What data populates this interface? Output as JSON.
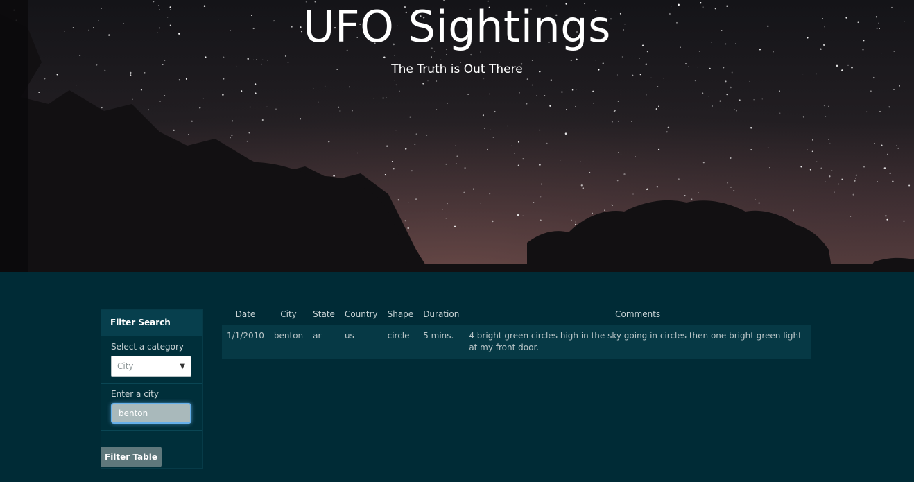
{
  "header": {
    "title": "UFO Sightings",
    "subtitle": "The Truth is Out There"
  },
  "filter": {
    "heading": "Filter Search",
    "category_label": "Select a category",
    "category_selected": "City",
    "input_label": "Enter a city",
    "input_value": "benton",
    "button_label": "Filter Table"
  },
  "table": {
    "headers": [
      "Date",
      "City",
      "State",
      "Country",
      "Shape",
      "Duration",
      "Comments"
    ],
    "rows": [
      [
        "1/1/2010",
        "benton",
        "ar",
        "us",
        "circle",
        "5 mins.",
        "4 bright green circles high in the sky going in circles then one bright green light at my front door."
      ]
    ]
  },
  "colors": {
    "page_background": "#002b36",
    "panel_header": "#073f4d",
    "row_background": "#063945",
    "button": "#5f787c",
    "focus_ring": "#66afe9"
  }
}
